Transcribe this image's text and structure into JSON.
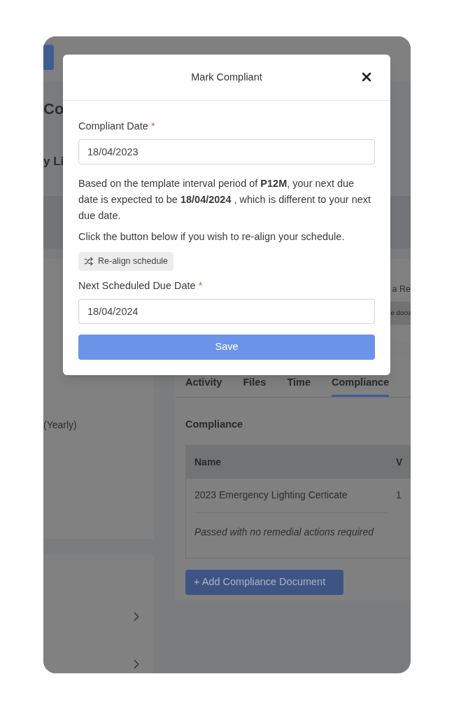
{
  "background": {
    "heading_fragment": "Co",
    "subheading_fragment": "y Li",
    "interval": "(Yearly)",
    "side_text_fragment": "a Re",
    "doc_pill_fragment": "e docu",
    "tabs": [
      {
        "label": "Activity",
        "selected": false
      },
      {
        "label": "Files",
        "selected": false
      },
      {
        "label": "Time",
        "selected": false
      },
      {
        "label": "Compliance",
        "selected": true
      }
    ],
    "section_title": "Compliance",
    "table": {
      "columns": [
        "Name",
        "V"
      ],
      "rows": [
        {
          "name": "2023 Emergency Lighting Certicate",
          "column_2": "1",
          "note": "Passed with no remedial actions required"
        }
      ]
    },
    "add_button": "+ Add Compliance Document"
  },
  "modal": {
    "title": "Mark Compliant",
    "required_mark": "*",
    "compliant_date": {
      "label": "Compliant Date",
      "required": true,
      "value": "18/04/2023"
    },
    "message": "Based on the template interval period of **P12M**, your next due date is expected to be **18/04/2024** , which is different to your next due date.",
    "hint": "Click the button below if you wish to re-align your schedule.",
    "realign_button": "Re-align schedule",
    "next_due_date": {
      "label": "Next Scheduled Due Date",
      "required": true,
      "value": "18/04/2024"
    },
    "save_button": "Save"
  }
}
